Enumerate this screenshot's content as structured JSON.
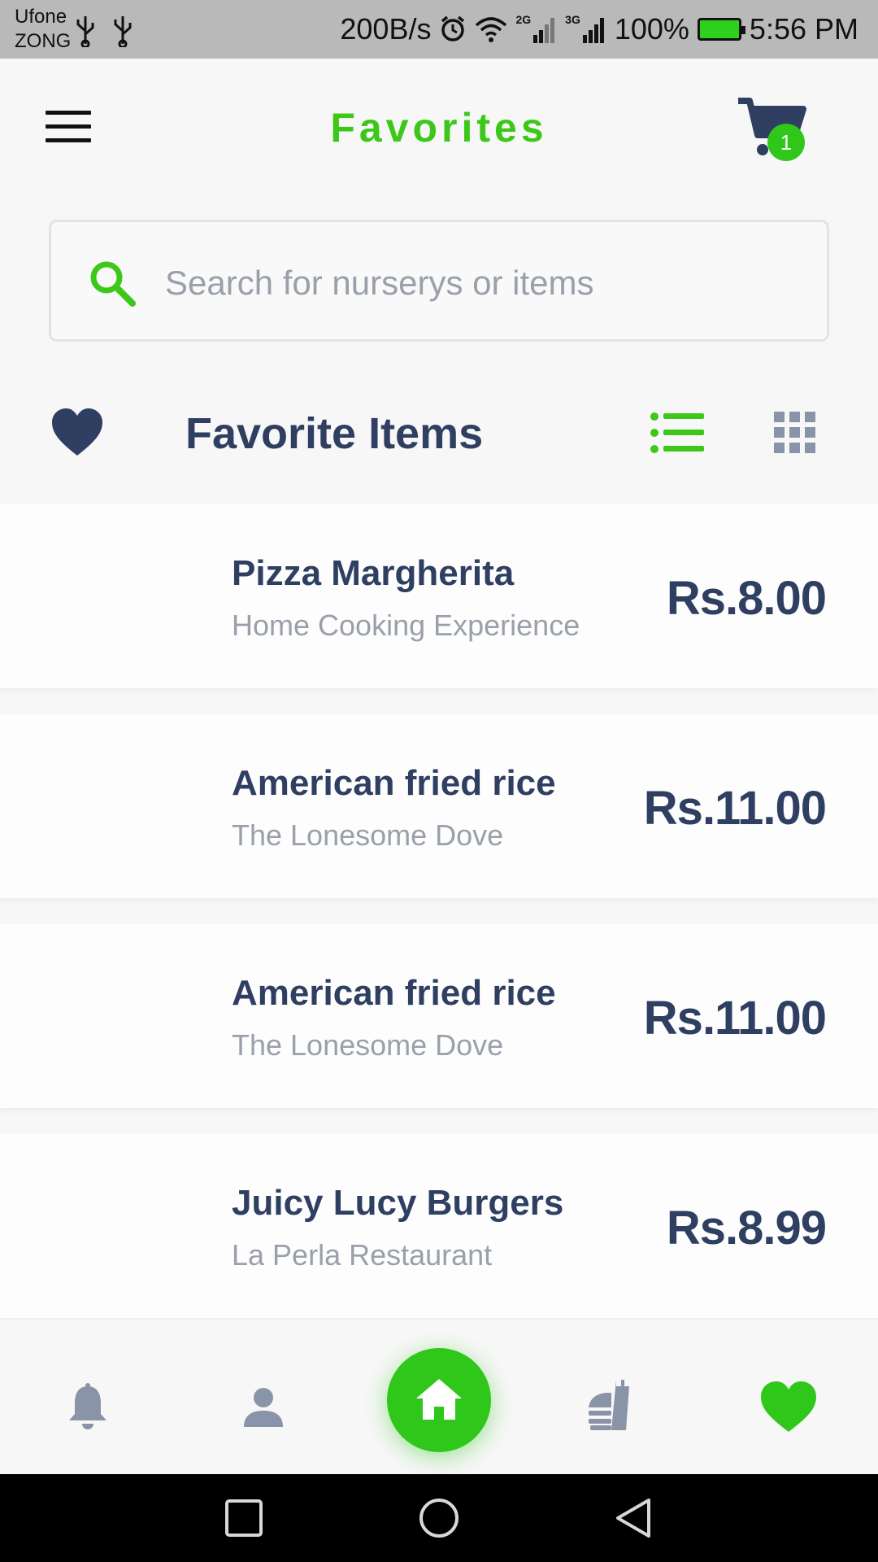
{
  "status_bar": {
    "carrier_top": "Ufone",
    "carrier_bottom": "ZONG",
    "speed": "200B/s",
    "net1": "2G",
    "net2": "3G",
    "battery": "100%",
    "time": "5:56 PM"
  },
  "header": {
    "title": "Favorites",
    "cart_count": "1"
  },
  "search": {
    "placeholder": "Search for nurserys or items",
    "value": ""
  },
  "section": {
    "title": "Favorite Items"
  },
  "items": [
    {
      "name": "Pizza Margherita",
      "restaurant": "Home Cooking Experience",
      "price": "Rs.8.00"
    },
    {
      "name": "American fried rice",
      "restaurant": "The Lonesome Dove",
      "price": "Rs.11.00"
    },
    {
      "name": "American fried rice",
      "restaurant": "The Lonesome Dove",
      "price": "Rs.11.00"
    },
    {
      "name": "Juicy Lucy Burgers",
      "restaurant": "La Perla Restaurant",
      "price": "Rs.8.99"
    }
  ],
  "colors": {
    "accent": "#3dc819",
    "text_primary": "#2f3f62",
    "text_secondary": "#9aa0aa",
    "icon_gray": "#8a94a8"
  },
  "icons": {
    "menu": "hamburger-menu-icon",
    "cart": "shopping-cart-icon",
    "search": "search-icon",
    "section": "heart-icon",
    "list_view": "list-view-icon",
    "grid_view": "grid-view-icon",
    "nav": [
      "bell-icon",
      "user-icon",
      "home-icon",
      "food-icon",
      "heart-icon"
    ]
  }
}
